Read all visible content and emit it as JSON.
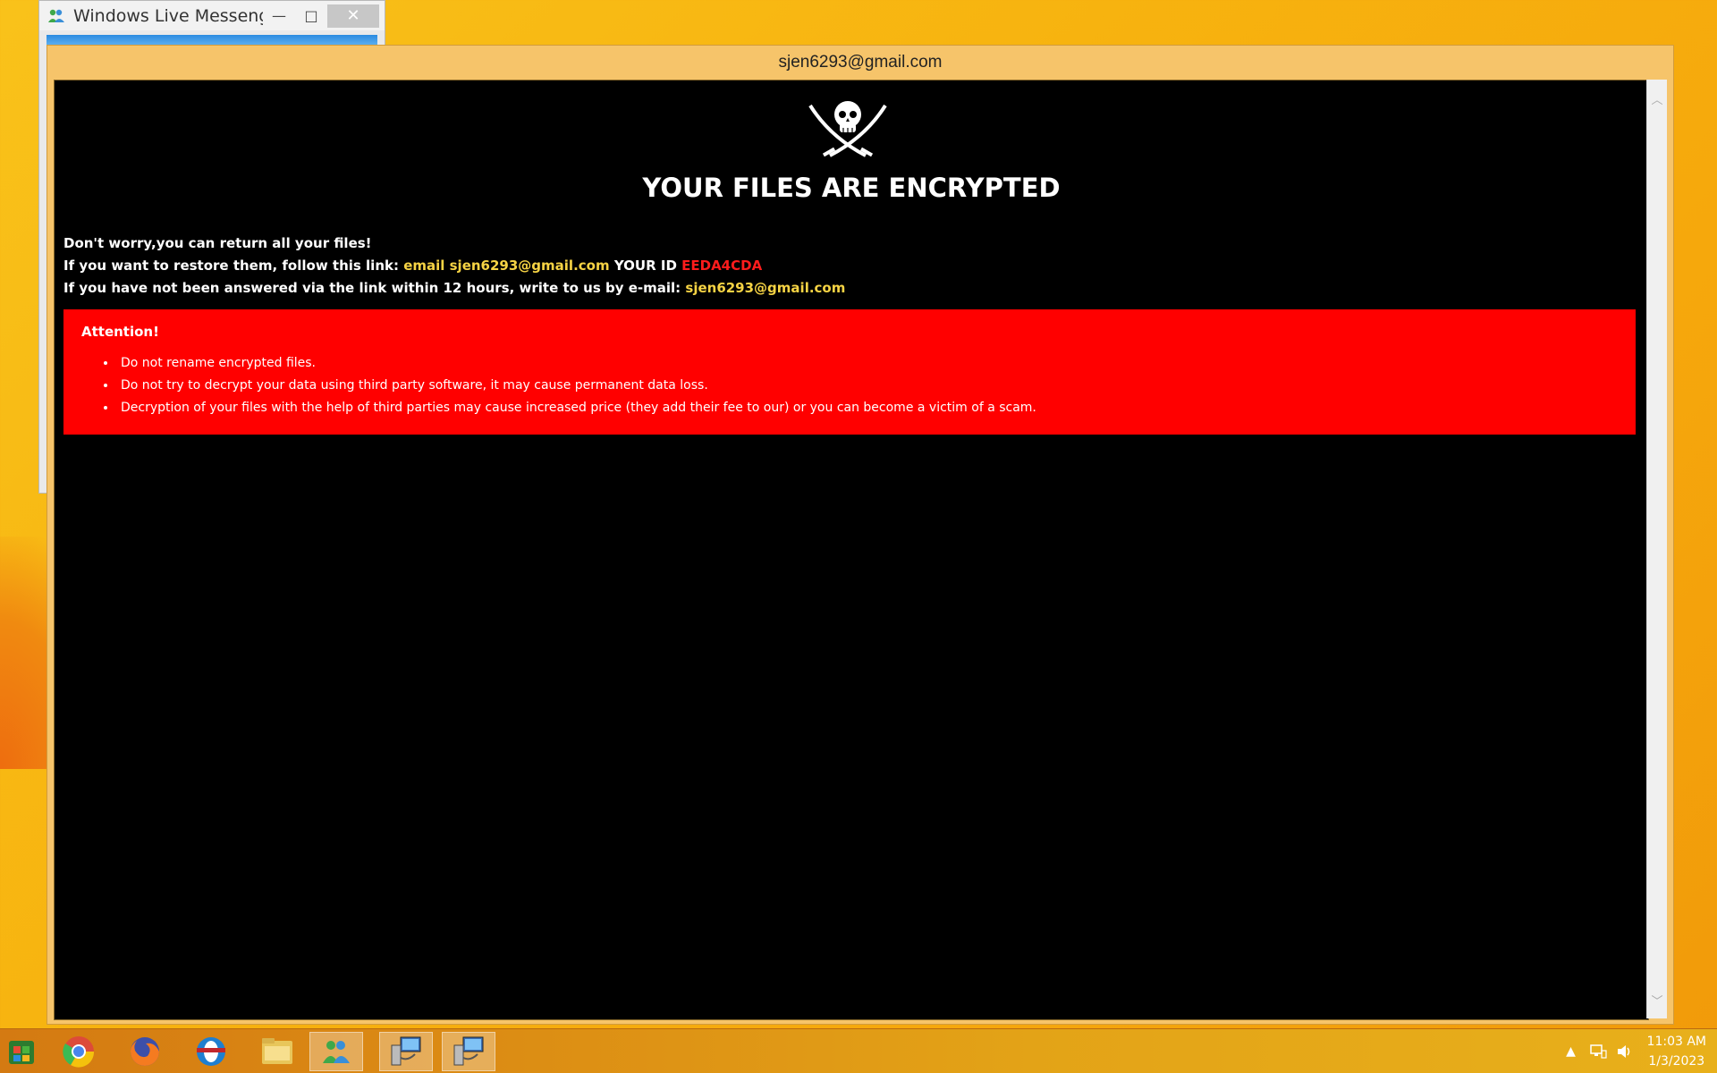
{
  "messenger_window": {
    "title": "Windows Live Messeng...",
    "minimize": "—",
    "maximize": "□",
    "close": "✕"
  },
  "main_window": {
    "title": "sjen6293@gmail.com"
  },
  "ransom_note": {
    "headline": "YOUR FILES ARE ENCRYPTED",
    "line1": "Don't worry,you can return all your files!",
    "line2_prefix": "If you want to restore them, follow this link: ",
    "line2_link": "email sjen6293@gmail.com",
    "line2_id_label": " YOUR ID ",
    "line2_id": "EEDA4CDA",
    "line3_prefix": "If you have not been answered via the link within 12 hours, write to us by e-mail: ",
    "line3_email": "sjen6293@gmail.com",
    "attention_title": "Attention!",
    "attention_items": [
      "Do not rename encrypted files.",
      "Do not try to decrypt your data using third party software, it may cause permanent data loss.",
      "Decryption of your files with the help of third parties may cause increased price (they add their fee to our) or you can become a victim of a scam."
    ]
  },
  "taskbar": {
    "icons": [
      "windows-store-icon",
      "chrome-icon",
      "firefox-icon",
      "opera-icon",
      "file-explorer-icon",
      "messenger-contacts-icon",
      "network-computer-icon",
      "network-computer-icon"
    ],
    "clock_time": "11:03 AM",
    "clock_date": "1/3/2023"
  },
  "colors": {
    "accent_yellow": "#f6d344",
    "id_red": "#ff1c1c",
    "attention_bg": "#ff0000",
    "window_frame": "#f6c46a"
  }
}
